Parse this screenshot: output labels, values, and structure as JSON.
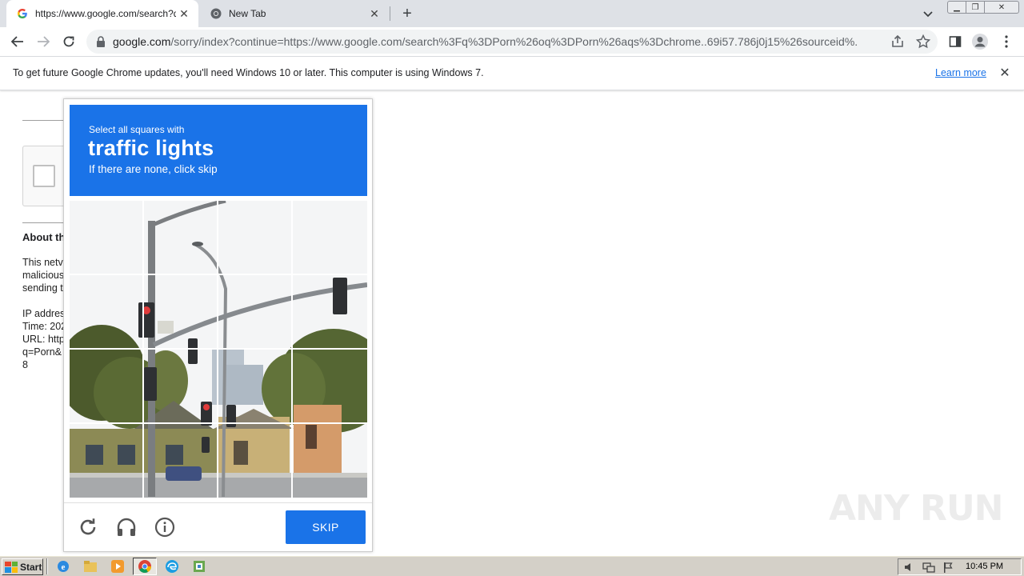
{
  "browser": {
    "tabs": [
      {
        "title": "https://www.google.com/search?q=",
        "favicon": "google-g-icon",
        "active": true
      },
      {
        "title": "New Tab",
        "favicon": "chrome-icon",
        "active": false
      }
    ],
    "url": {
      "host": "google.com",
      "path": "/sorry/index?continue=https://www.google.com/search%3Fq%3DPorn%26oq%3DPorn%26aqs%3Dchrome..69i57.786j0j15%26sourceid%..."
    },
    "infobar": {
      "message": "To get future Google Chrome updates, you'll need Windows 10 or later. This computer is using Windows 7.",
      "link": "Learn more"
    }
  },
  "page": {
    "about_title": "About th",
    "lines_1": [
      "This netv",
      "malicious",
      "sending t"
    ],
    "lines_2": [
      "IP addres",
      "Time: 202",
      "URL: http",
      "q=Porn&",
      "8"
    ]
  },
  "challenge": {
    "instruction": "Select all squares with",
    "object": "traffic lights",
    "note": "If there are none, click skip",
    "skip_label": "SKIP",
    "grid": {
      "rows": 4,
      "cols": 4
    }
  },
  "watermark": "ANY RUN",
  "taskbar": {
    "start_label": "Start",
    "clock": "10:45 PM"
  },
  "colors": {
    "accent_blue": "#1a73e8",
    "tab_strip": "#dee1e6",
    "taskbar": "#d4d0c8"
  }
}
